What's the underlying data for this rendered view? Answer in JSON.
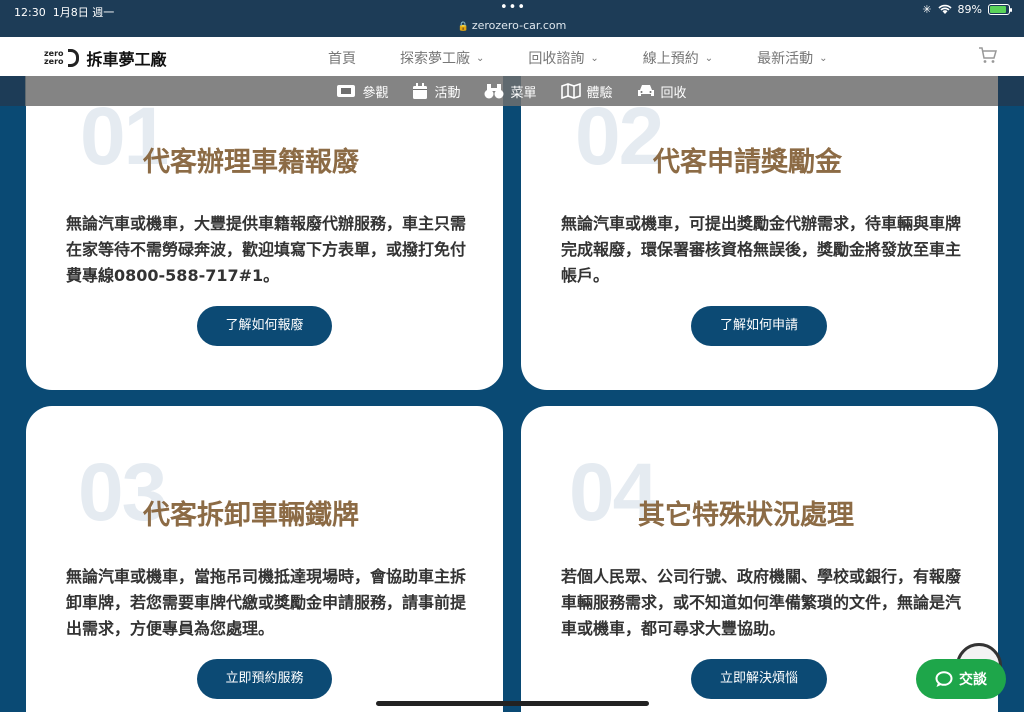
{
  "status": {
    "time": "12:30",
    "date": "1月8日 週一",
    "dots": "•••",
    "url": "zerozero-car.com",
    "battery": "89%",
    "battery_level": 0.89
  },
  "header": {
    "logo_small_1": "zero",
    "logo_small_2": "zero",
    "logo_text": "拆車夢工廠",
    "nav": [
      {
        "label": "首頁"
      },
      {
        "label": "探索夢工廠"
      },
      {
        "label": "回收諮詢"
      },
      {
        "label": "線上預約"
      },
      {
        "label": "最新活動"
      }
    ]
  },
  "subnav": [
    {
      "label": "參觀",
      "icon": "ticket-icon"
    },
    {
      "label": "活動",
      "icon": "calendar-icon"
    },
    {
      "label": "菜單",
      "icon": "binoculars-icon"
    },
    {
      "label": "體驗",
      "icon": "map-icon"
    },
    {
      "label": "回收",
      "icon": "car-icon"
    }
  ],
  "cards": [
    {
      "num": "01",
      "title": "代客辦理車籍報廢",
      "body": "無論汽車或機車，大豐提供車籍報廢代辦服務，車主只需在家等待不需勞碌奔波，歡迎填寫下方表單，或撥打免付費專線0800-588-717#1。",
      "button": "了解如何報廢"
    },
    {
      "num": "02",
      "title": "代客申請獎勵金",
      "body": "無論汽車或機車，可提出獎勵金代辦需求，待車輛與車牌完成報廢，環保署審核資格無誤後，獎勵金將發放至車主帳戶。",
      "button": "了解如何申請"
    },
    {
      "num": "03",
      "title": "代客拆卸車輛鐵牌",
      "body": "無論汽車或機車，當拖吊司機抵達現場時，會協助車主拆卸車牌，若您需要車牌代繳或獎勵金申請服務，請事前提出需求，方便專員為您處理。",
      "button": "立即預約服務"
    },
    {
      "num": "04",
      "title": "其它特殊狀況處理",
      "body": "若個人民眾、公司行號、政府機關、學校或銀行，有報廢車輛服務需求，或不知道如何準備繁瑣的文件，無論是汽車或機車，都可尋求大豐協助。",
      "button": "立即解決煩惱"
    }
  ],
  "chat": {
    "label": "交談"
  },
  "colors": {
    "background": "#0a4a74",
    "title": "#8c6b45",
    "button": "#0c4a74",
    "chat": "#1ea64a"
  }
}
